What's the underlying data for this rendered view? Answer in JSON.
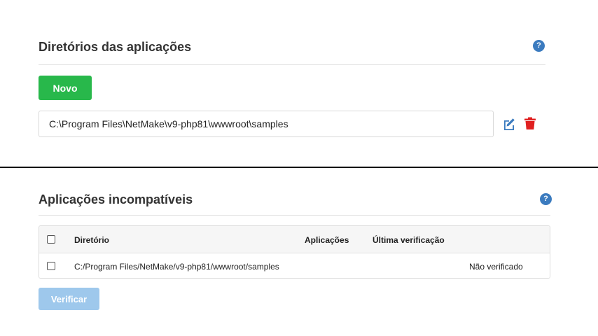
{
  "app_dirs": {
    "title": "Diretórios das aplicações",
    "help_icon": "?",
    "new_button": "Novo",
    "directory_value": "C:\\Program Files\\NetMake\\v9-php81\\wwwroot\\samples",
    "edit_icon": "pencil-square-icon",
    "delete_icon": "trash-icon",
    "colors": {
      "accent": "#28b84b",
      "delete": "#e02020",
      "edit": "#3b7bbf"
    }
  },
  "incompatible": {
    "title": "Aplicações incompatíveis",
    "help_icon": "?",
    "columns": {
      "directory": "Diretório",
      "applications": "Aplicações",
      "last_check": "Última verificação"
    },
    "rows": [
      {
        "directory": "C:/Program Files/NetMake/v9-php81/wwwroot/samples",
        "applications": "",
        "status": "Não verificado"
      }
    ],
    "verify_button": "Verificar",
    "colors": {
      "verify_disabled": "#9ec8ec"
    }
  }
}
